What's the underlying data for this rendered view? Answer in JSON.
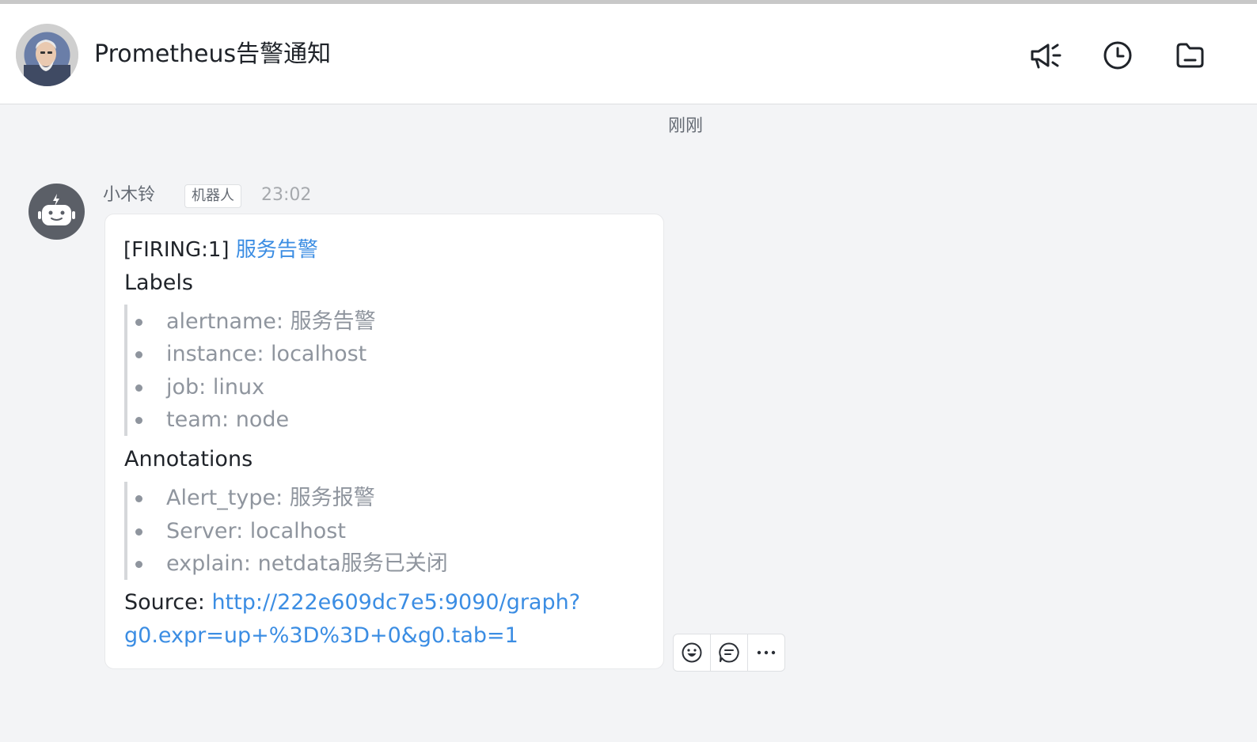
{
  "header": {
    "title": "Prometheus告警通知",
    "actions": [
      {
        "icon": "megaphone-icon",
        "label": "announcements"
      },
      {
        "icon": "clock-icon",
        "label": "history"
      },
      {
        "icon": "folder-icon",
        "label": "files"
      }
    ]
  },
  "time_divider": "刚刚",
  "message": {
    "sender": "小木铃",
    "badge": "机器人",
    "time": "23:02",
    "firing_prefix": "[FIRING:1]",
    "firing_link": "服务告警",
    "labels_heading": "Labels",
    "labels": [
      "alertname: 服务告警",
      "instance: localhost",
      "job: linux",
      "team: node"
    ],
    "annotations_heading": "Annotations",
    "annotations": [
      "Alert_type: 服务报警",
      "Server: localhost",
      "explain: netdata服务已关闭"
    ],
    "source_label": "Source:",
    "source_link_line1": "http://222e609dc7e5:9090/graph?",
    "source_link_line2": "g0.expr=up+%3D%3D+0&g0.tab=1"
  },
  "message_actions": [
    {
      "icon": "emoji-reaction-icon"
    },
    {
      "icon": "reply-icon"
    },
    {
      "icon": "more-icon"
    }
  ],
  "colors": {
    "link": "#3b8de3",
    "background": "#f3f4f6",
    "bot_avatar": "#5b5f67",
    "muted_text": "#8f959e"
  }
}
